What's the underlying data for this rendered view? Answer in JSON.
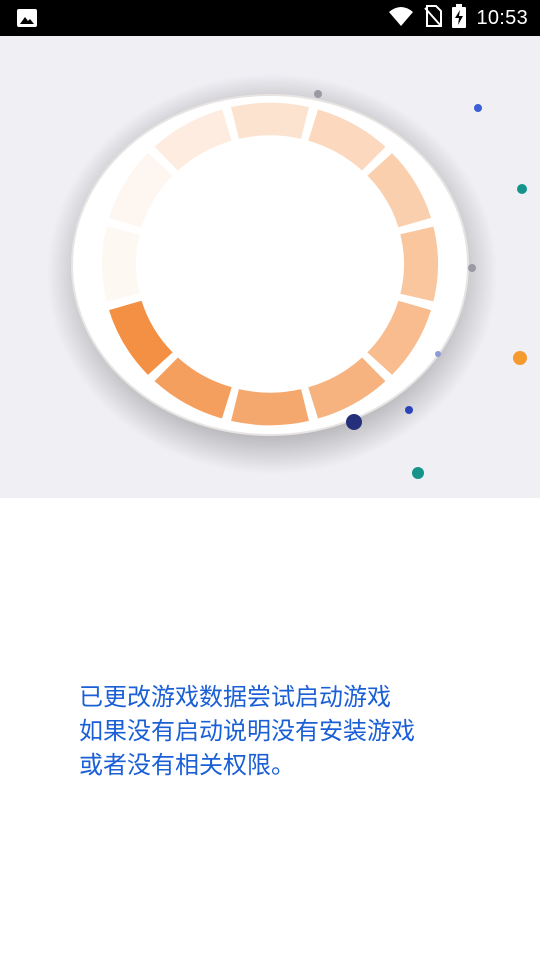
{
  "status_bar": {
    "time": "10:53",
    "icons": [
      "image-notification-icon",
      "wifi-icon",
      "no-sim-icon",
      "battery-charging-icon"
    ]
  },
  "hero": {
    "icon": "loading-ring-icon",
    "background": "#efeff4",
    "accent": "#f28a3a"
  },
  "message": {
    "line1": "已更改游戏数据尝试启动游戏",
    "line2": "如果没有启动说明没有安装游戏",
    "line3": "或者没有相关权限。",
    "color": "#1a5fd6"
  }
}
